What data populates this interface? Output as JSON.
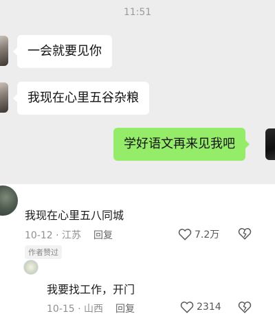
{
  "chat": {
    "time": "11:51",
    "messages": [
      {
        "side": "left",
        "text": "一会就要见你"
      },
      {
        "side": "left",
        "text": "我现在心里五谷杂粮"
      },
      {
        "side": "right",
        "text": "学好语文再来见我吧"
      }
    ]
  },
  "comments": [
    {
      "text": "我现在心里五八同城",
      "date": "10-12",
      "location": "江苏",
      "reply_label": "回复",
      "likes": "7.2万",
      "badge": "作者赞过"
    },
    {
      "text": "我要找工作，开门",
      "date": "10-15",
      "location": "山西",
      "reply_label": "回复",
      "likes": "2314"
    }
  ]
}
